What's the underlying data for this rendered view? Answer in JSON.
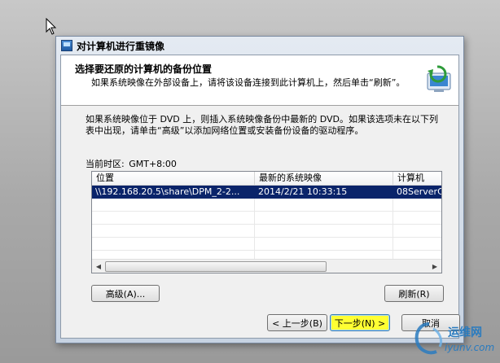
{
  "window": {
    "title": "对计算机进行重镜像"
  },
  "header": {
    "title": "选择要还原的计算机的备份位置",
    "subtitle": "如果系统映像在外部设备上，请将该设备连接到此计算机上，然后单击“刷新”。"
  },
  "info_text": "如果系统映像位于 DVD 上，则插入系统映像备份中最新的 DVD。如果该选项未在以下列表中出现，请单击“高级”以添加网络位置或安装备份设备的驱动程序。",
  "timezone": {
    "label": "当前时区:",
    "value": "GMT+8:00"
  },
  "table": {
    "headers": [
      "位置",
      "最新的系统映像",
      "计算机"
    ],
    "rows": [
      [
        "\\\\192.168.20.5\\share\\DPM_2-2...",
        "2014/2/21 10:33:15",
        "08ServerC"
      ]
    ]
  },
  "buttons": {
    "advanced": "高级(A)...",
    "refresh": "刷新(R)",
    "back": "< 上一步(B)",
    "next": "下一步(N) >",
    "cancel": "取消"
  },
  "watermark": {
    "text": "运维网",
    "sub": "iyunv.com"
  },
  "colors": {
    "selection": "#0a246a",
    "highlight": "#ffff33",
    "watermark": "#2a7bbf"
  }
}
